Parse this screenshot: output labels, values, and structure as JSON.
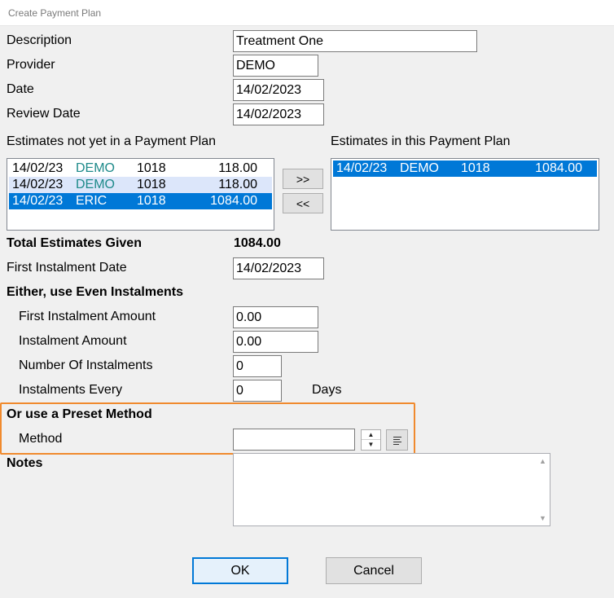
{
  "window": {
    "title": "Create Payment Plan"
  },
  "form": {
    "description_label": "Description",
    "description_value": "Treatment One",
    "provider_label": "Provider",
    "provider_value": "DEMO",
    "date_label": "Date",
    "date_value": "14/02/2023",
    "review_date_label": "Review Date",
    "review_date_value": "14/02/2023"
  },
  "estimates_available": {
    "label": "Estimates not yet in a Payment Plan",
    "rows": [
      {
        "date": "14/02/23",
        "provider": "DEMO",
        "code": "1018",
        "amount": "118.00"
      },
      {
        "date": "14/02/23",
        "provider": "DEMO",
        "code": "1018",
        "amount": "118.00"
      },
      {
        "date": "14/02/23",
        "provider": "ERIC",
        "code": "1018",
        "amount": "1084.00"
      }
    ]
  },
  "estimates_in_plan": {
    "label": "Estimates in this Payment Plan",
    "rows": [
      {
        "date": "14/02/23",
        "provider": "DEMO",
        "code": "1018",
        "amount": "1084.00"
      }
    ]
  },
  "transfer": {
    "add_label": ">>",
    "remove_label": "<<"
  },
  "totals": {
    "label": "Total Estimates Given",
    "value": "1084.00"
  },
  "first_instalment_date": {
    "label": "First Instalment Date",
    "value": "14/02/2023"
  },
  "even": {
    "heading": "Either, use Even Instalments",
    "first_amount_label": "First Instalment Amount",
    "first_amount_value": "0.00",
    "amount_label": "Instalment Amount",
    "amount_value": "0.00",
    "count_label": "Number Of Instalments",
    "count_value": "0",
    "every_label": "Instalments Every",
    "every_value": "0",
    "days_label": "Days"
  },
  "preset": {
    "heading": "Or use a Preset Method",
    "method_label": "Method",
    "method_value": "",
    "highlight_color": "#f08a2e"
  },
  "notes": {
    "label": "Notes",
    "value": ""
  },
  "buttons": {
    "ok_label": "OK",
    "cancel_label": "Cancel"
  },
  "colors": {
    "selection": "#0078d7",
    "alt_row": "#dce6fa",
    "provider_text": "#1e8a8a"
  }
}
